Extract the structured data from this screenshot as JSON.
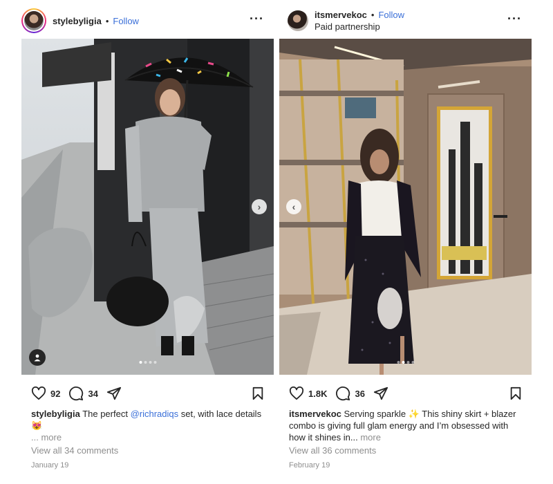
{
  "posts": [
    {
      "username": "stylebyligia",
      "follow_label": "Follow",
      "likes": "92",
      "comments_count": "34",
      "caption_user": "stylebyligia",
      "caption_before": " The perfect ",
      "mention": "@richradiqs",
      "caption_after": " set, with lace details",
      "emoji": "😻",
      "more_label": "... more",
      "view_comments": "View all 34 comments",
      "date": "January 19",
      "carousel_slides": 4,
      "carousel_active": 1
    },
    {
      "username": "itsmervekoc",
      "follow_label": "Follow",
      "subtitle": "Paid partnership",
      "likes": "1.8K",
      "comments_count": "36",
      "caption_user": "itsmervekoc",
      "caption_text": " Serving sparkle ✨ This shiny skirt + blazer combo is giving full glam energy and I’m obsessed with how it shines in...",
      "more_label": " more",
      "view_comments": "View all 36 comments",
      "date": "February 19",
      "carousel_slides": 4,
      "carousel_active": 2
    }
  ],
  "icons": [
    "more-options-icon",
    "heart-icon",
    "comment-icon",
    "share-icon",
    "bookmark-icon",
    "user-tag-icon",
    "chevron-right-icon",
    "chevron-left-icon"
  ],
  "colors": {
    "link": "#3a6fd8",
    "text": "#262626",
    "muted": "#8e8e8e"
  }
}
